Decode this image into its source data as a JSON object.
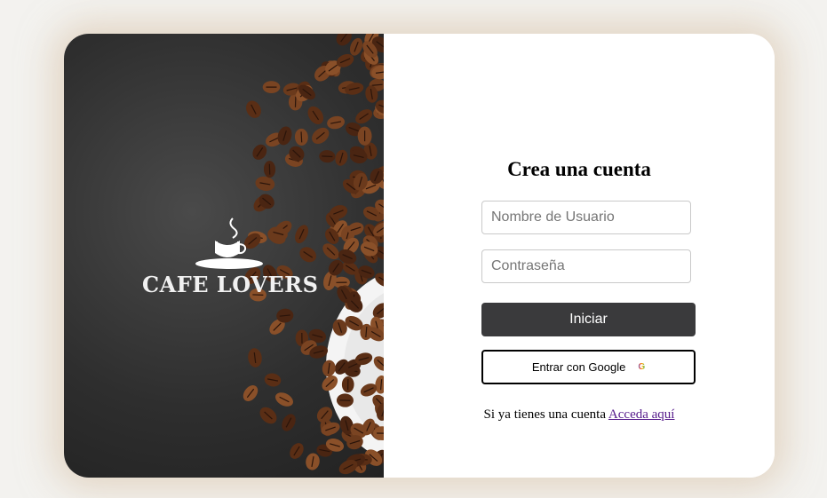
{
  "brand": {
    "name": "CAFE LOVERS"
  },
  "form": {
    "title": "Crea una cuenta",
    "username_placeholder": "Nombre de Usuario",
    "password_placeholder": "Contraseña",
    "start_label": "Iniciar",
    "google_label": "Entrar con Google",
    "google_icon": "G",
    "footer_text": "Si ya tienes una cuenta ",
    "footer_link": "Acceda aquí"
  }
}
